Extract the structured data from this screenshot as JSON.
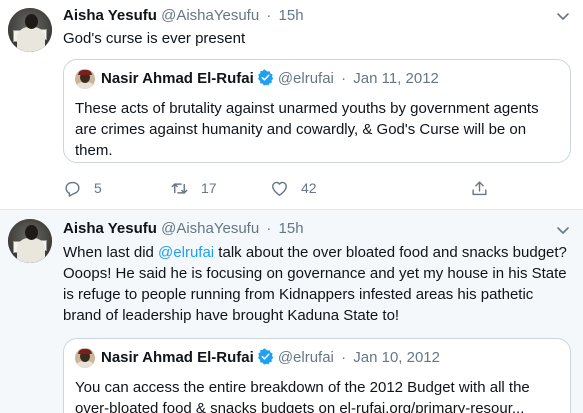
{
  "tweets": [
    {
      "author_name": "Aisha Yesufu",
      "author_handle": "@AishaYesufu",
      "separator": "·",
      "time": "15h",
      "text": "God's curse is ever present",
      "quoted": {
        "author_name": "Nasir Ahmad El-Rufai",
        "author_handle": "@elrufai",
        "separator": "·",
        "date": "Jan 11, 2012",
        "text": "These acts of brutality against unarmed youths by government agents are crimes against humanity and cowardly, & God's Curse will be on them."
      },
      "actions": {
        "replies": "5",
        "retweets": "17",
        "likes": "42"
      }
    },
    {
      "author_name": "Aisha Yesufu",
      "author_handle": "@AishaYesufu",
      "separator": "·",
      "time": "15h",
      "text_before_mention": "When last did ",
      "mention": "@elrufai",
      "text_after_mention": " talk about the over bloated food and snacks budget? Ooops! He said he is focusing on governance and yet my house in his State is refuge to people running from Kidnappers infested areas his pathetic brand of leadership have brought Kaduna State to!",
      "quoted": {
        "author_name": "Nasir Ahmad El-Rufai",
        "author_handle": "@elrufai",
        "separator": "·",
        "date": "Jan 10, 2012",
        "text": "You can access the entire breakdown of the 2012 Budget with all the over-bloated food & snacks budgets on el-rufai.org/primary-resour..."
      }
    }
  ],
  "icons": {
    "more": "chevron-down-icon",
    "verified": "verified-badge-icon",
    "reply": "reply-icon",
    "retweet": "retweet-icon",
    "like": "heart-icon",
    "share": "share-icon"
  },
  "colors": {
    "accent": "#1da1f2",
    "muted": "#657786",
    "border": "#ccd6dd",
    "highlight_background": "#f5f8fa"
  }
}
